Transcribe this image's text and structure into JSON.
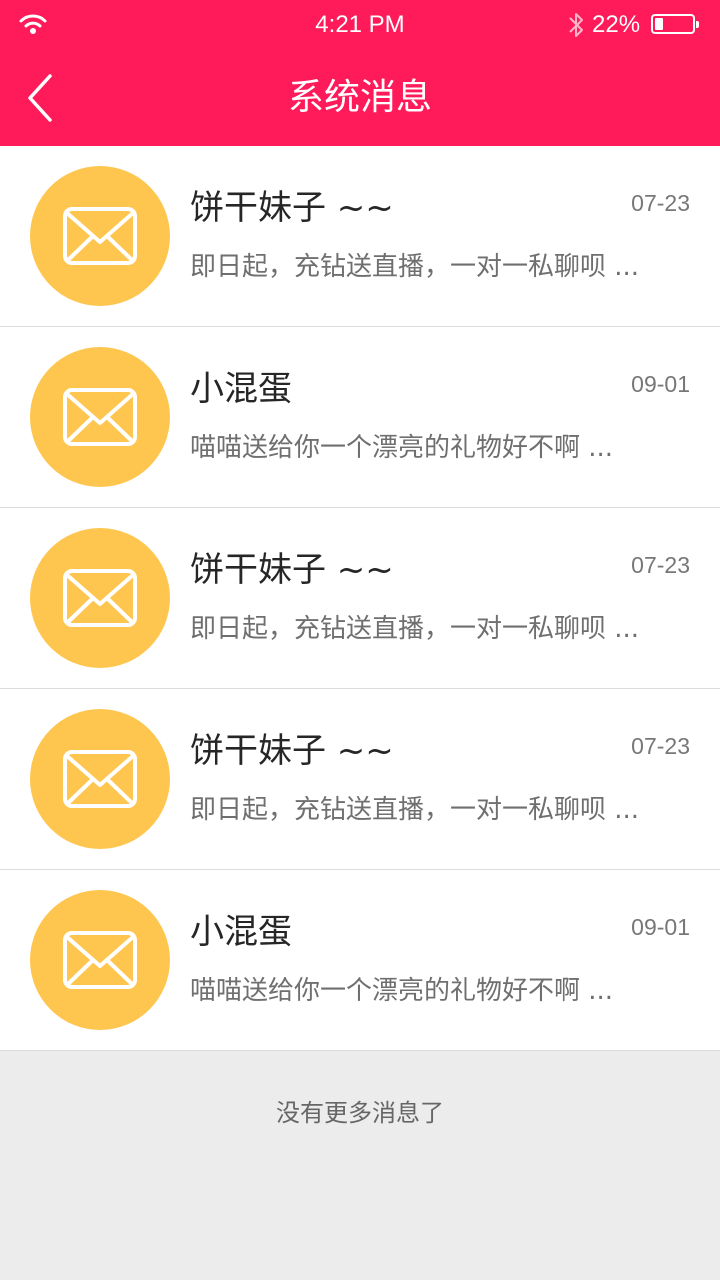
{
  "status_bar": {
    "time": "4:21 PM",
    "battery": "22%",
    "battery_level": 0.22
  },
  "nav": {
    "title": "系统消息"
  },
  "messages": [
    {
      "name": "饼干妹子 ~~",
      "date": "07-23",
      "preview": "即日起，充钻送直播，一对一私聊呗 ..."
    },
    {
      "name": "小混蛋",
      "date": "09-01",
      "preview": "喵喵送给你一个漂亮的礼物好不啊 ..."
    },
    {
      "name": "饼干妹子 ~~",
      "date": "07-23",
      "preview": "即日起，充钻送直播，一对一私聊呗 ..."
    },
    {
      "name": "饼干妹子 ~~",
      "date": "07-23",
      "preview": "即日起，充钻送直播，一对一私聊呗 ..."
    },
    {
      "name": "小混蛋",
      "date": "09-01",
      "preview": "喵喵送给你一个漂亮的礼物好不啊 ..."
    }
  ],
  "footer": {
    "text": "没有更多消息了"
  },
  "icons": {
    "avatar": "mail-icon",
    "back": "chevron-left-icon"
  },
  "colors": {
    "header": "#ff1a5a",
    "avatar": "#fec64f",
    "page_bg": "#ececec"
  }
}
